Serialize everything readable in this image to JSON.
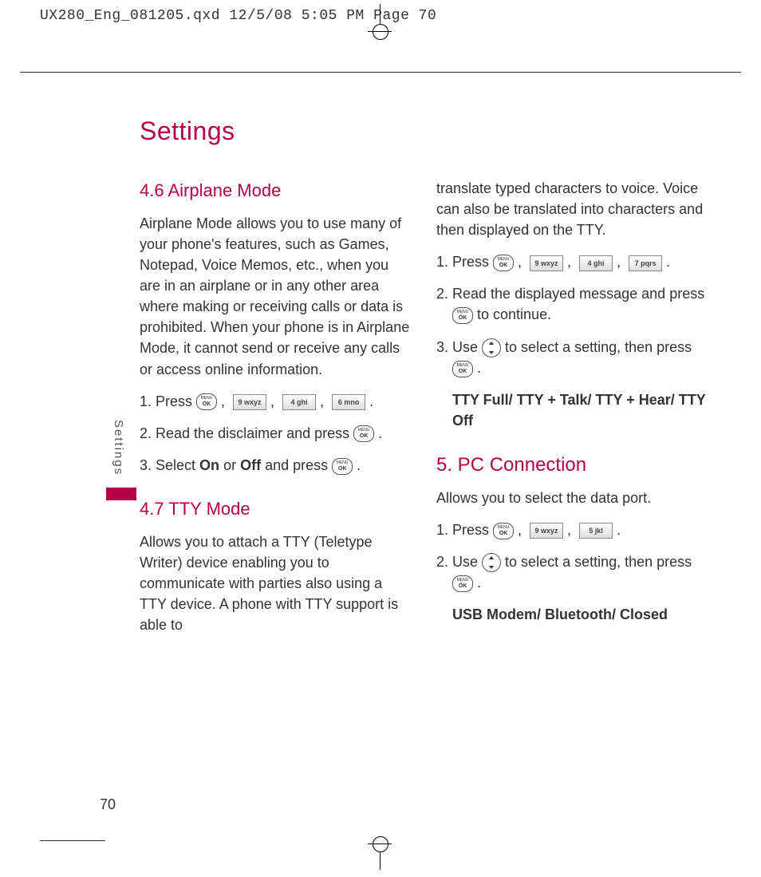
{
  "crop_header": "UX280_Eng_081205.qxd  12/5/08  5:05 PM  Page 70",
  "page_title": "Settings",
  "side_tab": "Settings",
  "page_number": "70",
  "keys": {
    "ok": "MENU OK",
    "k9": "9 wxyz",
    "k4": "4 ghi",
    "k6": "6 mno",
    "k7": "7 pqrs",
    "k5": "5 jkl"
  },
  "left": {
    "s46_title": "4.6 Airplane Mode",
    "s46_body": "Airplane Mode allows you to use many of your phone's features, such as Games, Notepad, Voice Memos, etc., when you are in an airplane or in any other area where making or receiving calls or data is prohibited. When your phone is in Airplane Mode, it cannot send or receive any calls or access online information.",
    "s46_step1_a": "1. Press ",
    "s46_step2_a": "2. Read the disclaimer and press ",
    "s46_step3_a": "3. Select ",
    "s46_step3_on": "On",
    "s46_step3_or": " or ",
    "s46_step3_off": "Off",
    "s46_step3_b": " and press ",
    "s47_title": "4.7 TTY Mode",
    "s47_body": "Allows you to attach a TTY (Teletype Writer) device enabling you to communicate with parties also using a TTY device. A phone with TTY support is able to"
  },
  "right": {
    "tty_cont": "translate typed characters to voice. Voice can also be translated into characters and then displayed on the TTY.",
    "tty_step1_a": "1. Press ",
    "tty_step2_a": "2. Read the displayed message and press ",
    "tty_step2_b": " to continue.",
    "tty_step3_a": "3. Use ",
    "tty_step3_b": " to select a setting, then press ",
    "tty_options": "TTY Full/ TTY + Talk/ TTY + Hear/ TTY Off",
    "s5_title": "5. PC Connection",
    "s5_body": "Allows you to select the data port.",
    "s5_step1_a": "1. Press ",
    "s5_step2_a": "2. Use ",
    "s5_step2_b": " to select a setting, then press ",
    "s5_options": "USB Modem/ Bluetooth/ Closed"
  }
}
